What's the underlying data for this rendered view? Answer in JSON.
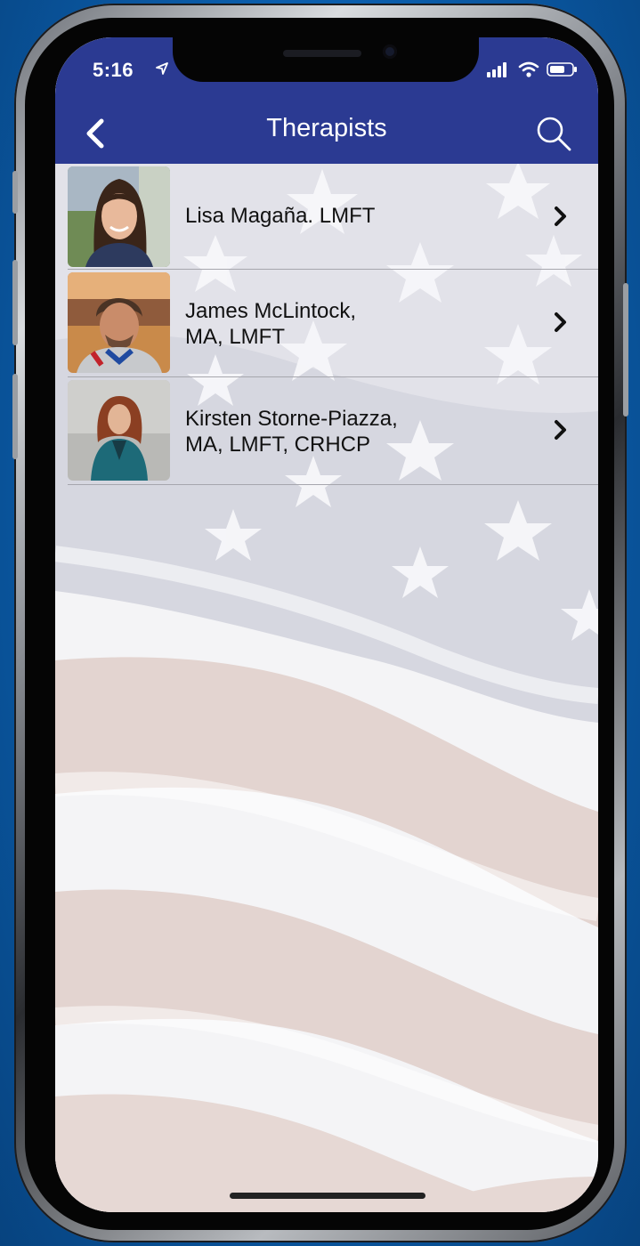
{
  "status_bar": {
    "time": "5:16",
    "location_icon": "location-arrow-icon",
    "signal_icon": "cellular-signal-icon",
    "wifi_icon": "wifi-icon",
    "battery_icon": "battery-icon"
  },
  "nav": {
    "title": "Therapists",
    "back_icon": "chevron-left-icon",
    "search_icon": "search-icon",
    "background_color": "#2b3a92"
  },
  "therapists": [
    {
      "name_line1": "Lisa Magaña. LMFT",
      "name_line2": ""
    },
    {
      "name_line1": "James McLintock,",
      "name_line2": "MA, LMFT"
    },
    {
      "name_line1": "Kirsten Storne-Piazza,",
      "name_line2": "MA, LMFT, CRHCP"
    }
  ],
  "row_chevron_icon": "chevron-right-icon"
}
